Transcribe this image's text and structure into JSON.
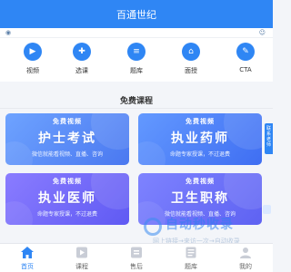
{
  "header": {
    "title": "百通世纪"
  },
  "quick_nav": [
    {
      "label": "视频",
      "icon": "video-play-icon"
    },
    {
      "label": "选课",
      "icon": "select-course-icon"
    },
    {
      "label": "题库",
      "icon": "question-bank-icon"
    },
    {
      "label": "面授",
      "icon": "face-to-face-icon"
    },
    {
      "label": "CTA",
      "icon": "cta-icon"
    }
  ],
  "section": {
    "title": "免费课程"
  },
  "cards": [
    {
      "tag": "免费视频",
      "title": "护士考试",
      "subtitle": "微信就能看视频、直播、咨询"
    },
    {
      "tag": "免费视频",
      "title": "执业药师",
      "subtitle": "命题专家授课，不过退费"
    },
    {
      "tag": "免费视频",
      "title": "执业医师",
      "subtitle": "命题专家授课，不过退费"
    },
    {
      "tag": "免费视频",
      "title": "卫生职称",
      "subtitle": "微信就能看视频、直播、咨询"
    }
  ],
  "side_tab": {
    "label": "联系老师"
  },
  "watermark": {
    "title": "自动秒收录",
    "subtitle": "网上链接→来访一次→自动收录"
  },
  "tabbar": [
    {
      "label": "首页",
      "icon": "home-icon",
      "active": true
    },
    {
      "label": "课程",
      "icon": "course-play-icon",
      "active": false
    },
    {
      "label": "售后",
      "icon": "after-sales-icon",
      "active": false
    },
    {
      "label": "题库",
      "icon": "question-bank-icon",
      "active": false
    },
    {
      "label": "我的",
      "icon": "profile-icon",
      "active": false
    }
  ],
  "colors": {
    "primary": "#2f86f4",
    "background": "#f3f5f9"
  }
}
